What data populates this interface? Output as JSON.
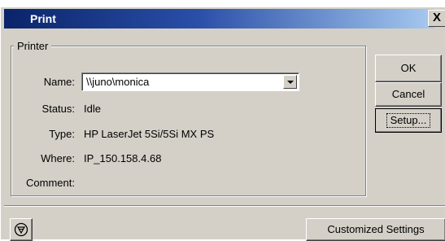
{
  "window": {
    "title": "Print",
    "close_label": "X"
  },
  "printer_group": {
    "label": "Printer",
    "fields": {
      "name_label": "Name:",
      "name_value": "\\\\juno\\monica",
      "status_label": "Status:",
      "status_value": "Idle",
      "type_label": "Type:",
      "type_value": "HP LaserJet 5Si/5Si MX PS",
      "where_label": "Where:",
      "where_value": "IP_150.158.4.68",
      "comment_label": "Comment:",
      "comment_value": ""
    }
  },
  "buttons": {
    "ok": "OK",
    "cancel": "Cancel",
    "setup": "Setup...",
    "customized": "Customized Settings"
  },
  "icons": {
    "bottom_left": "adobe-logo-icon",
    "combo_arrow": "chevron-down-icon",
    "close": "close-icon"
  }
}
